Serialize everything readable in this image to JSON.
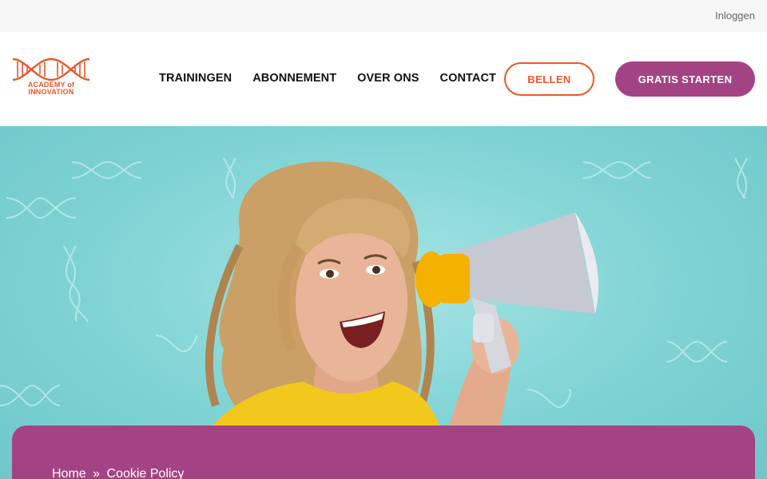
{
  "topbar": {
    "login_label": "Inloggen"
  },
  "logo": {
    "line1": "ACADEMY of",
    "line2": "INNOVATION"
  },
  "nav": {
    "items": [
      {
        "label": "TRAININGEN"
      },
      {
        "label": "ABONNEMENT"
      },
      {
        "label": "OVER ONS"
      },
      {
        "label": "CONTACT"
      }
    ]
  },
  "buttons": {
    "call_label": "BELLEN",
    "start_label": "GRATIS STARTEN"
  },
  "breadcrumb": {
    "home": "Home",
    "separator": "»",
    "current": "Cookie Policy"
  },
  "colors": {
    "brand_orange": "#e8572a",
    "brand_purple": "#a44383",
    "hero_teal": "#7fd3d4",
    "shirt_yellow": "#f3c81c"
  },
  "hero": {
    "image": "woman-with-megaphone"
  }
}
